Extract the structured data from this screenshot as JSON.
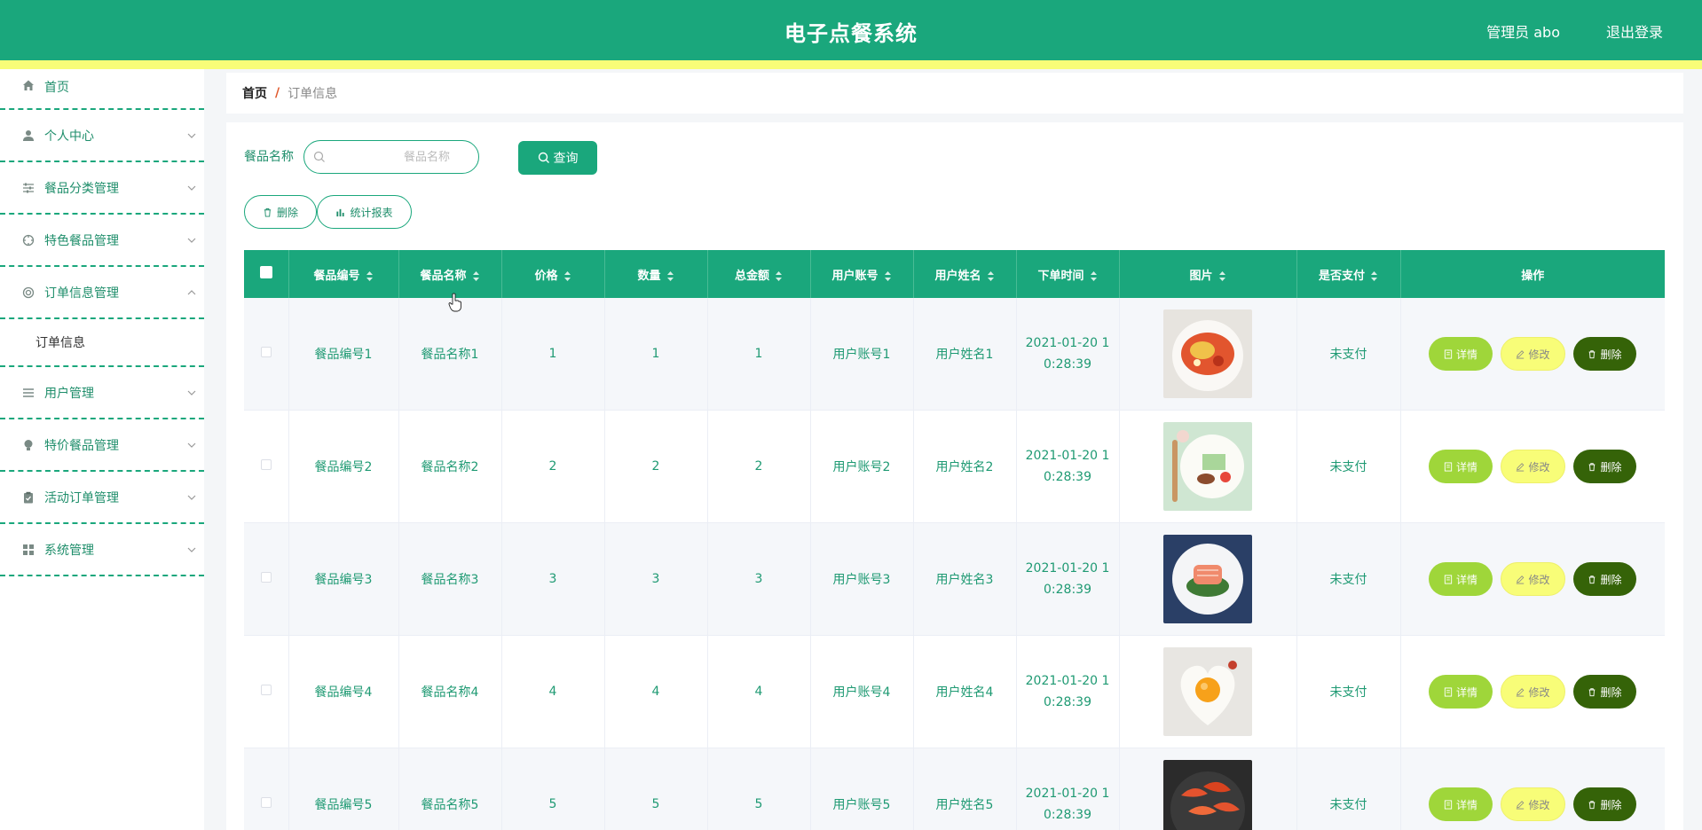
{
  "header": {
    "title": "电子点餐系统",
    "user": "管理员 abo",
    "logout": "退出登录",
    "colors": {
      "primary": "#1aa77c",
      "stripe": "#f8fd78"
    }
  },
  "sidebar": {
    "items": [
      {
        "label": "首页",
        "icon": "home-icon"
      },
      {
        "label": "个人中心",
        "icon": "user-icon"
      },
      {
        "label": "餐品分类管理",
        "icon": "sliders-icon"
      },
      {
        "label": "特色餐品管理",
        "icon": "compass-icon"
      },
      {
        "label": "订单信息管理",
        "icon": "lifebuoy-icon",
        "expanded": true,
        "children": [
          "订单信息"
        ]
      },
      {
        "label": "用户管理",
        "icon": "list-icon"
      },
      {
        "label": "特价餐品管理",
        "icon": "bulb-icon"
      },
      {
        "label": "活动订单管理",
        "icon": "clipboard-icon"
      },
      {
        "label": "系统管理",
        "icon": "grid-icon"
      }
    ]
  },
  "breadcrumb": {
    "home": "首页",
    "separator": "/",
    "current": "订单信息"
  },
  "search": {
    "label": "餐品名称",
    "placeholder": "餐品名称",
    "value": "",
    "query_button": "查询"
  },
  "toolbar": {
    "delete_button": "删除",
    "report_button": "统计报表"
  },
  "table": {
    "columns": [
      "餐品编号",
      "餐品名称",
      "价格",
      "数量",
      "总金额",
      "用户账号",
      "用户姓名",
      "下单时间",
      "图片",
      "是否支付",
      "操作"
    ],
    "rows": [
      {
        "code": "餐品编号1",
        "name": "餐品名称1",
        "price": "1",
        "qty": "1",
        "total": "1",
        "account": "用户账号1",
        "username": "用户姓名1",
        "time": "2021-01-20 10:28:39",
        "image": "pasta-plate",
        "paid": "未支付"
      },
      {
        "code": "餐品编号2",
        "name": "餐品名称2",
        "price": "2",
        "qty": "2",
        "total": "2",
        "account": "用户账号2",
        "username": "用户姓名2",
        "time": "2021-01-20 10:28:39",
        "image": "breakfast-plate",
        "paid": "未支付"
      },
      {
        "code": "餐品编号3",
        "name": "餐品名称3",
        "price": "3",
        "qty": "3",
        "total": "3",
        "account": "用户账号3",
        "username": "用户姓名3",
        "time": "2021-01-20 10:28:39",
        "image": "salmon-plate",
        "paid": "未支付"
      },
      {
        "code": "餐品编号4",
        "name": "餐品名称4",
        "price": "4",
        "qty": "4",
        "total": "4",
        "account": "用户账号4",
        "username": "用户姓名4",
        "time": "2021-01-20 10:28:39",
        "image": "heart-egg",
        "paid": "未支付"
      },
      {
        "code": "餐品编号5",
        "name": "餐品名称5",
        "price": "5",
        "qty": "5",
        "total": "5",
        "account": "用户账号5",
        "username": "用户姓名5",
        "time": "2021-01-20 10:28:39",
        "image": "shrimp-pan",
        "paid": "未支付"
      }
    ],
    "actions": {
      "detail": "详情",
      "edit": "修改",
      "delete": "删除"
    }
  }
}
